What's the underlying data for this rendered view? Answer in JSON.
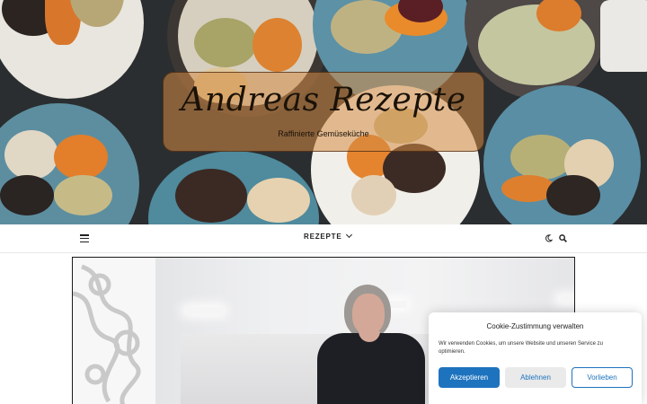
{
  "header": {
    "site_title": "Andreas Rezepte",
    "tagline": "Raffinierte Gemüseküche"
  },
  "nav": {
    "menu_icon": "hamburger-icon",
    "items": [
      {
        "label": "REZEPTE"
      }
    ],
    "dark_mode_icon": "moon-icon",
    "search_icon": "search-icon"
  },
  "cookie_banner": {
    "title": "Cookie-Zustimmung verwalten",
    "text": "Wir verwenden Cookies, um unsere Website und unseren Service zu optimieren.",
    "accept_label": "Akzeptieren",
    "reject_label": "Ablehnen",
    "preferences_label": "Vorlieben"
  },
  "colors": {
    "accent": "#1e73be",
    "title_box": "#d68c46"
  }
}
